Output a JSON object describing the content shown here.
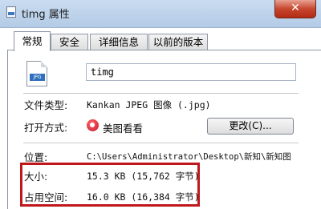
{
  "window": {
    "title": "timg 属性",
    "close_glyph": "✕"
  },
  "tabs": [
    {
      "label": "常规",
      "active": true
    },
    {
      "label": "安全",
      "active": false
    },
    {
      "label": "详细信息",
      "active": false
    },
    {
      "label": "以前的版本",
      "active": false
    }
  ],
  "file": {
    "icon_label": "JPG",
    "name": "timg"
  },
  "properties": {
    "file_type_label": "文件类型:",
    "file_type_value": "Kankan JPEG 图像 (.jpg)",
    "open_with_label": "打开方式:",
    "open_with_app": "美图看看",
    "change_button": "更改(C)...",
    "location_label": "位置:",
    "location_value": "C:\\Users\\Administrator\\Desktop\\新知\\新知图",
    "size_label": "大小:",
    "size_value": "15.3 KB (15,762 字节)",
    "disk_size_label": "占用空间:",
    "disk_size_value": "16.0 KB (16,384 字节)"
  },
  "colors": {
    "highlight_box": "#c0171d",
    "titlebar": "#c9dcf0"
  }
}
